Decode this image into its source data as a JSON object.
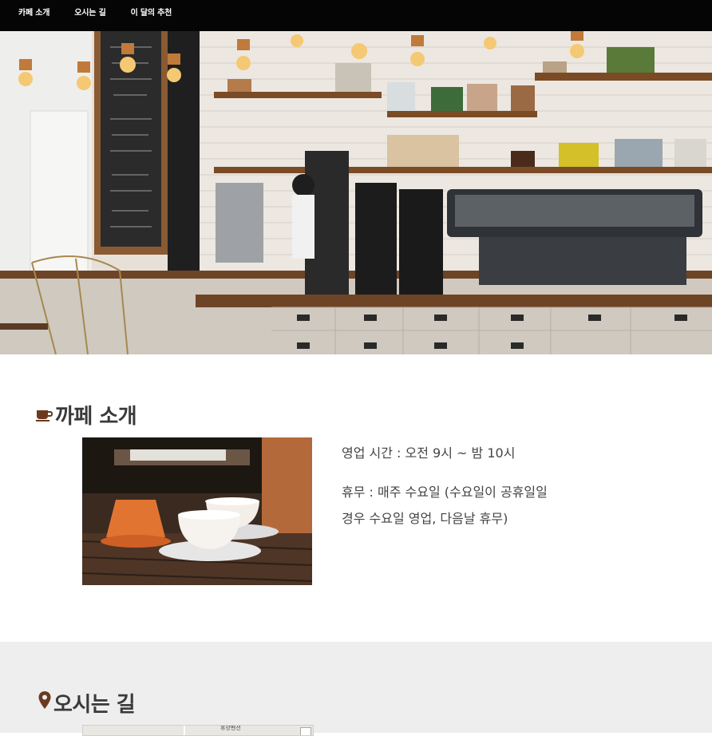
{
  "nav": {
    "items": [
      {
        "label": "카페 소개"
      },
      {
        "label": "오시는 길"
      },
      {
        "label": "이 달의 추천"
      }
    ]
  },
  "intro": {
    "title": "까페 소개",
    "hours": "영업 시간 : 오전 9시 ~ 밤 10시",
    "closed_line1": "휴무 : 매주 수요일 (수요일이 공휴일일",
    "closed_line2": "경우 수요일 영업, 다음날 휴무)",
    "icon": "coffee-cup-icon"
  },
  "location": {
    "title": "오시는 길",
    "icon": "map-pin-icon",
    "map_label": "휴양펜션"
  },
  "colors": {
    "nav_bg": "#050505",
    "accent_brown": "#6b3a1e",
    "band_bg": "#eeeeee"
  }
}
